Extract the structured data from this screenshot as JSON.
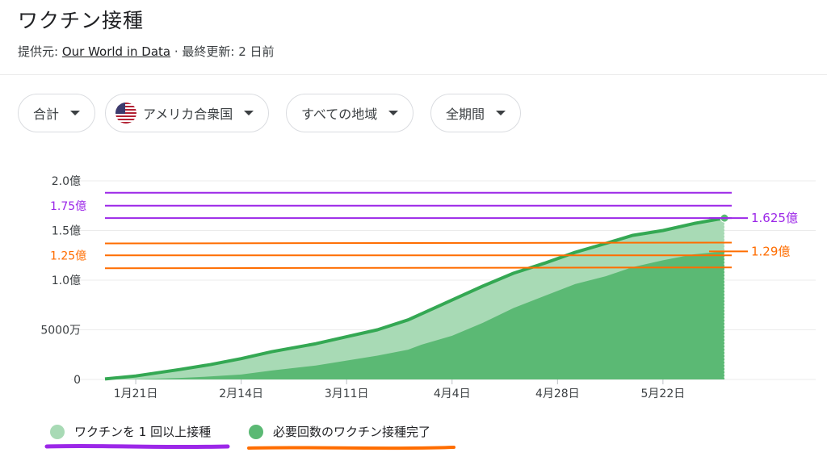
{
  "header": {
    "title": "ワクチン接種",
    "source_prefix": "提供元: ",
    "source_name": "Our World in Data",
    "updated": " · 最終更新: 2 日前"
  },
  "filters": [
    {
      "label": "合計"
    },
    {
      "label": "アメリカ合衆国",
      "flag": "us-flag-icon"
    },
    {
      "label": "すべての地域"
    },
    {
      "label": "全期間"
    }
  ],
  "colors": {
    "series_light": "#a8dab5",
    "series_dark": "#5bb974",
    "line": "#34a853",
    "purple": "#9c27e8",
    "orange": "#ff6d00"
  },
  "chart_data": {
    "type": "area",
    "x_tick_labels": [
      "1月21日",
      "2月14日",
      "3月11日",
      "4月4日",
      "4月28日",
      "5月22日"
    ],
    "y_tick_labels": [
      "0",
      "5000万",
      "1.0億",
      "1.5億",
      "2.0億"
    ],
    "y_ticks": [
      0,
      50,
      100,
      150,
      200
    ],
    "ylim": [
      0,
      200
    ],
    "y_unit": "百万",
    "x_days": [
      -7,
      0,
      10,
      17,
      24,
      31,
      41,
      48,
      55,
      62,
      65,
      72,
      79,
      86,
      93,
      100,
      107,
      113,
      120,
      127,
      134
    ],
    "series": [
      {
        "name": "ワクチンを 1 回以上接種",
        "values": [
          0.5,
          3.5,
          10,
          15,
          21,
          28,
          36,
          43,
          50,
          60,
          66,
          80,
          94,
          107,
          117,
          128,
          137,
          145,
          150,
          157,
          162.5
        ]
      },
      {
        "name": "必要回数のワクチン接種完了",
        "values": [
          0,
          0.2,
          1.5,
          3,
          5,
          9,
          14,
          19,
          24,
          30,
          35,
          44,
          57,
          72,
          84,
          96,
          104,
          113,
          120,
          126,
          129
        ]
      }
    ],
    "annotations": [
      {
        "label": "1.75億",
        "value": 175,
        "color": "purple",
        "side": "left"
      },
      {
        "label": "1.25億",
        "value": 125,
        "color": "orange",
        "side": "left"
      },
      {
        "label": "1.625億",
        "value": 162.5,
        "color": "purple",
        "side": "right"
      },
      {
        "label": "1.29億",
        "value": 129,
        "color": "orange",
        "side": "right"
      }
    ],
    "reference_lines": [
      {
        "value": 188,
        "color": "purple"
      },
      {
        "value": 175,
        "color": "purple"
      },
      {
        "value": 162.5,
        "color": "purple"
      },
      {
        "value": 137,
        "color": "orange"
      },
      {
        "value": 125,
        "color": "orange"
      },
      {
        "value": 112,
        "color": "orange"
      }
    ]
  }
}
